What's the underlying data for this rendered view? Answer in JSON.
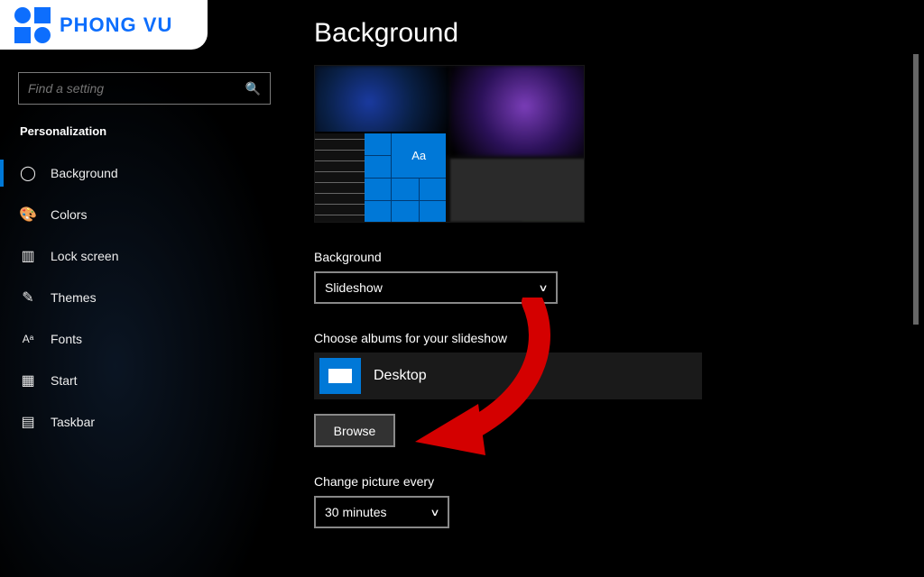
{
  "logo": {
    "text": "PHONG VU"
  },
  "sidebar": {
    "search_placeholder": "Find a setting",
    "section": "Personalization",
    "items": [
      {
        "label": "Background"
      },
      {
        "label": "Colors"
      },
      {
        "label": "Lock screen"
      },
      {
        "label": "Themes"
      },
      {
        "label": "Fonts"
      },
      {
        "label": "Start"
      },
      {
        "label": "Taskbar"
      }
    ]
  },
  "content": {
    "title": "Background",
    "preview_sample_text": "Aa",
    "bg_label": "Background",
    "bg_value": "Slideshow",
    "albums_label": "Choose albums for your slideshow",
    "album_name": "Desktop",
    "browse": "Browse",
    "interval_label": "Change picture every",
    "interval_value": "30 minutes"
  }
}
